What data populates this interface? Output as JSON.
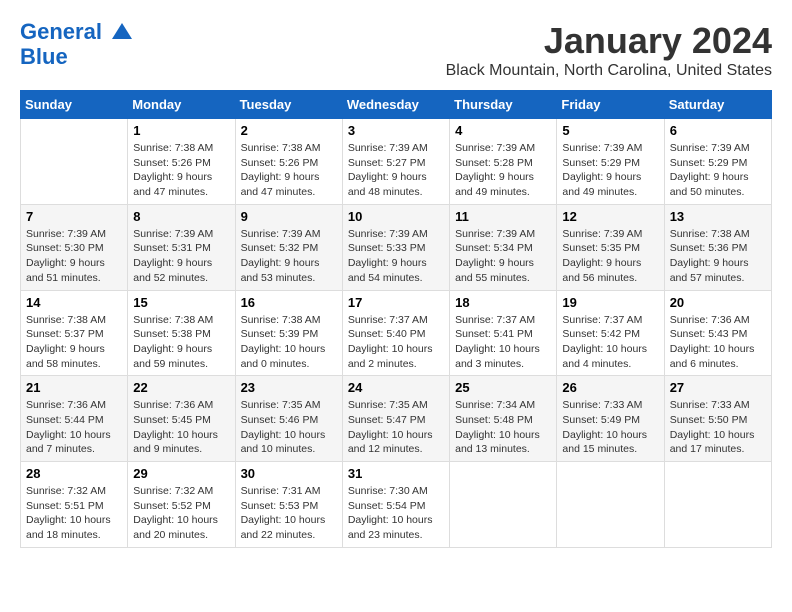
{
  "logo": {
    "line1": "General",
    "line2": "Blue"
  },
  "title": "January 2024",
  "location": "Black Mountain, North Carolina, United States",
  "weekdays": [
    "Sunday",
    "Monday",
    "Tuesday",
    "Wednesday",
    "Thursday",
    "Friday",
    "Saturday"
  ],
  "weeks": [
    [
      {
        "day": "",
        "sunrise": "",
        "sunset": "",
        "daylight": ""
      },
      {
        "day": "1",
        "sunrise": "7:38 AM",
        "sunset": "5:26 PM",
        "daylight": "9 hours and 47 minutes."
      },
      {
        "day": "2",
        "sunrise": "7:38 AM",
        "sunset": "5:26 PM",
        "daylight": "9 hours and 47 minutes."
      },
      {
        "day": "3",
        "sunrise": "7:39 AM",
        "sunset": "5:27 PM",
        "daylight": "9 hours and 48 minutes."
      },
      {
        "day": "4",
        "sunrise": "7:39 AM",
        "sunset": "5:28 PM",
        "daylight": "9 hours and 49 minutes."
      },
      {
        "day": "5",
        "sunrise": "7:39 AM",
        "sunset": "5:29 PM",
        "daylight": "9 hours and 49 minutes."
      },
      {
        "day": "6",
        "sunrise": "7:39 AM",
        "sunset": "5:29 PM",
        "daylight": "9 hours and 50 minutes."
      }
    ],
    [
      {
        "day": "7",
        "sunrise": "7:39 AM",
        "sunset": "5:30 PM",
        "daylight": "9 hours and 51 minutes."
      },
      {
        "day": "8",
        "sunrise": "7:39 AM",
        "sunset": "5:31 PM",
        "daylight": "9 hours and 52 minutes."
      },
      {
        "day": "9",
        "sunrise": "7:39 AM",
        "sunset": "5:32 PM",
        "daylight": "9 hours and 53 minutes."
      },
      {
        "day": "10",
        "sunrise": "7:39 AM",
        "sunset": "5:33 PM",
        "daylight": "9 hours and 54 minutes."
      },
      {
        "day": "11",
        "sunrise": "7:39 AM",
        "sunset": "5:34 PM",
        "daylight": "9 hours and 55 minutes."
      },
      {
        "day": "12",
        "sunrise": "7:39 AM",
        "sunset": "5:35 PM",
        "daylight": "9 hours and 56 minutes."
      },
      {
        "day": "13",
        "sunrise": "7:38 AM",
        "sunset": "5:36 PM",
        "daylight": "9 hours and 57 minutes."
      }
    ],
    [
      {
        "day": "14",
        "sunrise": "7:38 AM",
        "sunset": "5:37 PM",
        "daylight": "9 hours and 58 minutes."
      },
      {
        "day": "15",
        "sunrise": "7:38 AM",
        "sunset": "5:38 PM",
        "daylight": "9 hours and 59 minutes."
      },
      {
        "day": "16",
        "sunrise": "7:38 AM",
        "sunset": "5:39 PM",
        "daylight": "10 hours and 0 minutes."
      },
      {
        "day": "17",
        "sunrise": "7:37 AM",
        "sunset": "5:40 PM",
        "daylight": "10 hours and 2 minutes."
      },
      {
        "day": "18",
        "sunrise": "7:37 AM",
        "sunset": "5:41 PM",
        "daylight": "10 hours and 3 minutes."
      },
      {
        "day": "19",
        "sunrise": "7:37 AM",
        "sunset": "5:42 PM",
        "daylight": "10 hours and 4 minutes."
      },
      {
        "day": "20",
        "sunrise": "7:36 AM",
        "sunset": "5:43 PM",
        "daylight": "10 hours and 6 minutes."
      }
    ],
    [
      {
        "day": "21",
        "sunrise": "7:36 AM",
        "sunset": "5:44 PM",
        "daylight": "10 hours and 7 minutes."
      },
      {
        "day": "22",
        "sunrise": "7:36 AM",
        "sunset": "5:45 PM",
        "daylight": "10 hours and 9 minutes."
      },
      {
        "day": "23",
        "sunrise": "7:35 AM",
        "sunset": "5:46 PM",
        "daylight": "10 hours and 10 minutes."
      },
      {
        "day": "24",
        "sunrise": "7:35 AM",
        "sunset": "5:47 PM",
        "daylight": "10 hours and 12 minutes."
      },
      {
        "day": "25",
        "sunrise": "7:34 AM",
        "sunset": "5:48 PM",
        "daylight": "10 hours and 13 minutes."
      },
      {
        "day": "26",
        "sunrise": "7:33 AM",
        "sunset": "5:49 PM",
        "daylight": "10 hours and 15 minutes."
      },
      {
        "day": "27",
        "sunrise": "7:33 AM",
        "sunset": "5:50 PM",
        "daylight": "10 hours and 17 minutes."
      }
    ],
    [
      {
        "day": "28",
        "sunrise": "7:32 AM",
        "sunset": "5:51 PM",
        "daylight": "10 hours and 18 minutes."
      },
      {
        "day": "29",
        "sunrise": "7:32 AM",
        "sunset": "5:52 PM",
        "daylight": "10 hours and 20 minutes."
      },
      {
        "day": "30",
        "sunrise": "7:31 AM",
        "sunset": "5:53 PM",
        "daylight": "10 hours and 22 minutes."
      },
      {
        "day": "31",
        "sunrise": "7:30 AM",
        "sunset": "5:54 PM",
        "daylight": "10 hours and 23 minutes."
      },
      {
        "day": "",
        "sunrise": "",
        "sunset": "",
        "daylight": ""
      },
      {
        "day": "",
        "sunrise": "",
        "sunset": "",
        "daylight": ""
      },
      {
        "day": "",
        "sunrise": "",
        "sunset": "",
        "daylight": ""
      }
    ]
  ],
  "labels": {
    "sunrise_prefix": "Sunrise: ",
    "sunset_prefix": "Sunset: ",
    "daylight_prefix": "Daylight: "
  }
}
